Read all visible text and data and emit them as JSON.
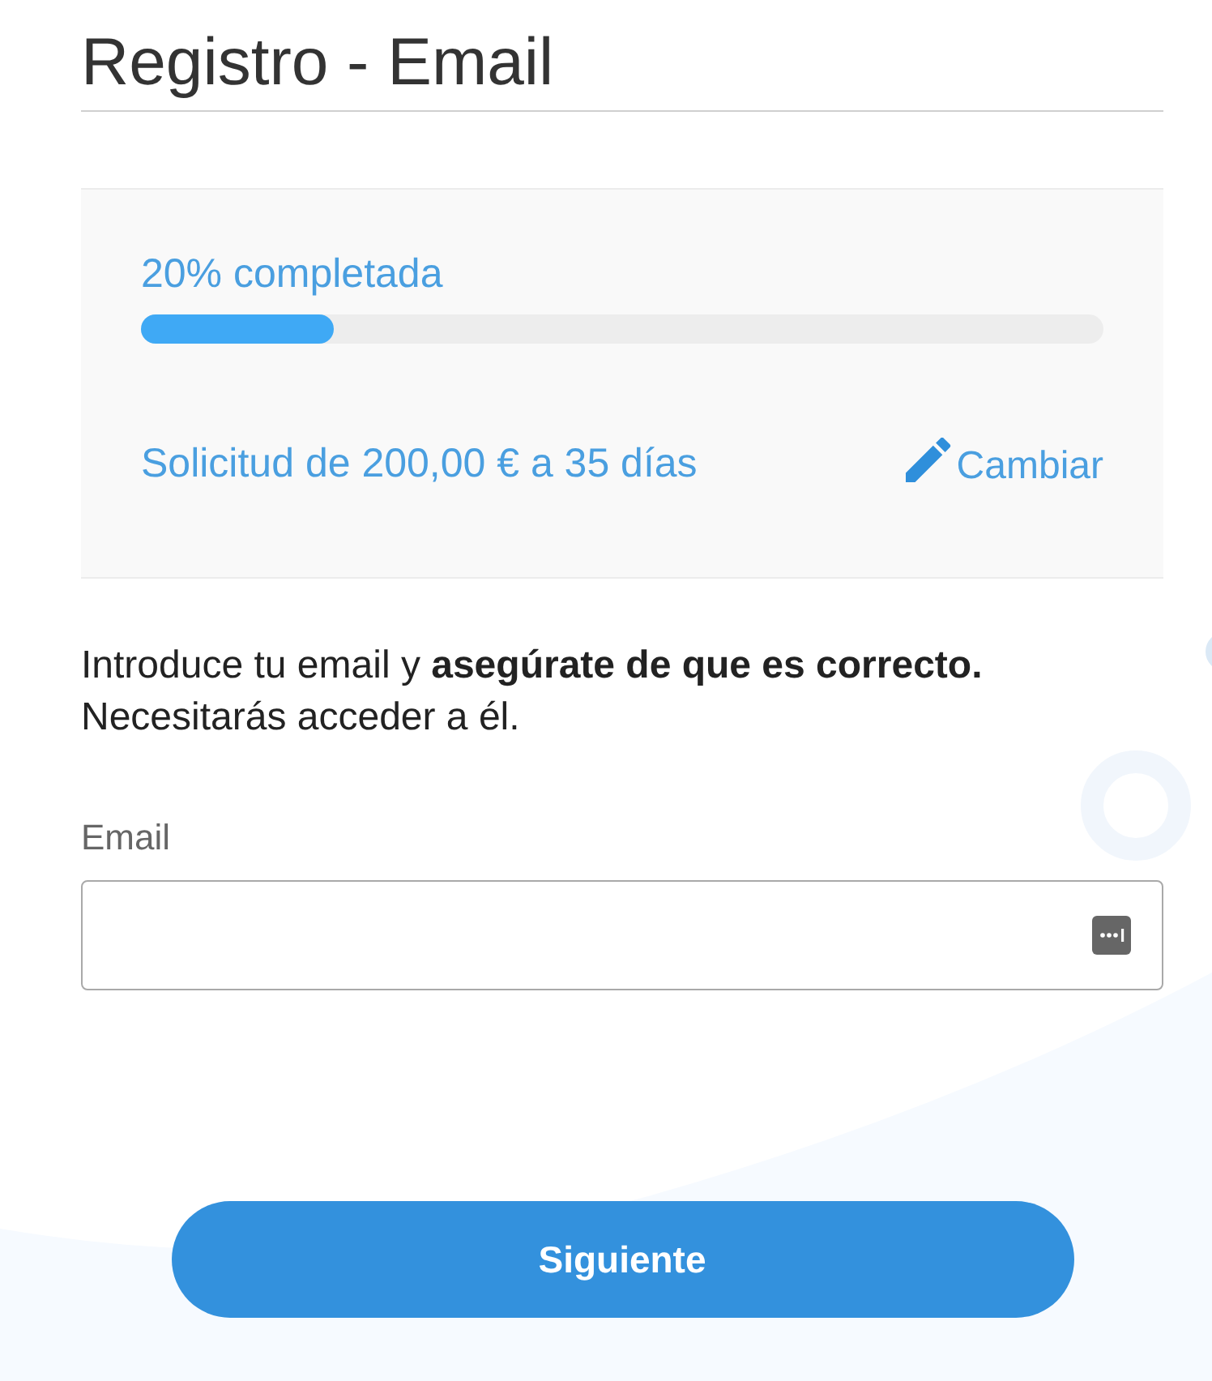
{
  "header": {
    "title": "Registro - Email"
  },
  "progress": {
    "label": "20% completada",
    "level": 0.2
  },
  "request": {
    "summary": "Solicitud de 200,00 € a 35 días",
    "change_link": "Cambiar"
  },
  "intro": "Introduce tu email y **asegúrate de que es correcto.** Necesitarás acceder a él.",
  "email_field": {
    "label": "Email"
  },
  "submit_button": "Siguiente"
}
